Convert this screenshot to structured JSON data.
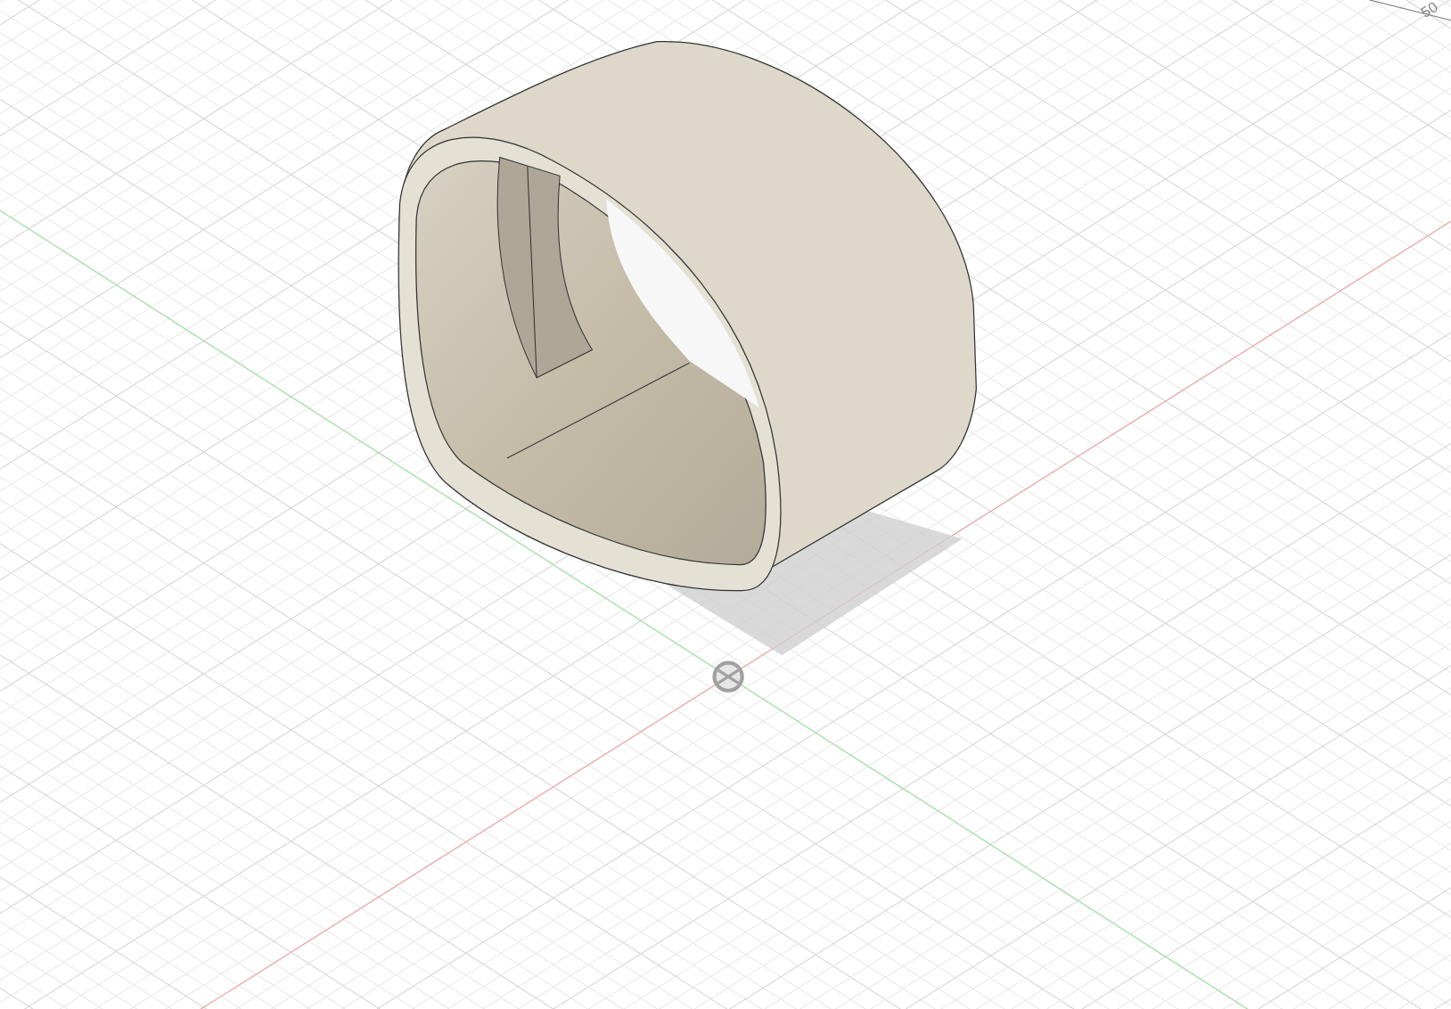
{
  "viewport": {
    "grid_label": "50"
  }
}
